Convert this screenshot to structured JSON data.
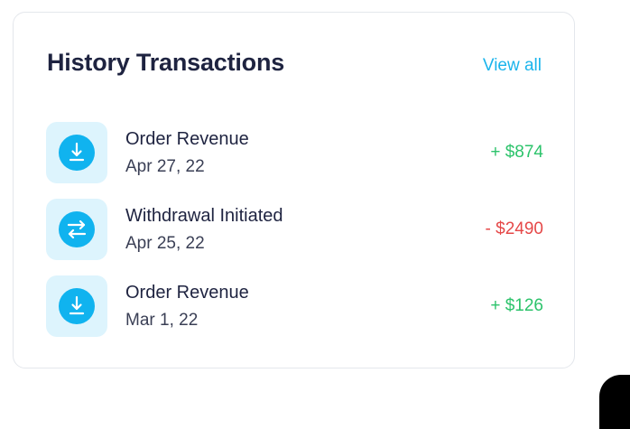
{
  "card": {
    "title": "History Transactions",
    "view_all_label": "View all"
  },
  "transactions": [
    {
      "icon": "download-icon",
      "name": "Order Revenue",
      "date": "Apr 27, 22",
      "amount": "+ $874",
      "direction": "positive"
    },
    {
      "icon": "transfer-icon",
      "name": "Withdrawal Initiated",
      "date": "Apr 25, 22",
      "amount": "- $2490",
      "direction": "negative"
    },
    {
      "icon": "download-icon",
      "name": "Order Revenue",
      "date": "Mar 1, 22",
      "amount": "+ $126",
      "direction": "positive"
    }
  ],
  "colors": {
    "accent": "#10b3ef",
    "icon_bg": "#ddf4fd",
    "positive": "#2cc36b",
    "negative": "#e54848",
    "title": "#1e2340",
    "link": "#1ab4ec"
  }
}
